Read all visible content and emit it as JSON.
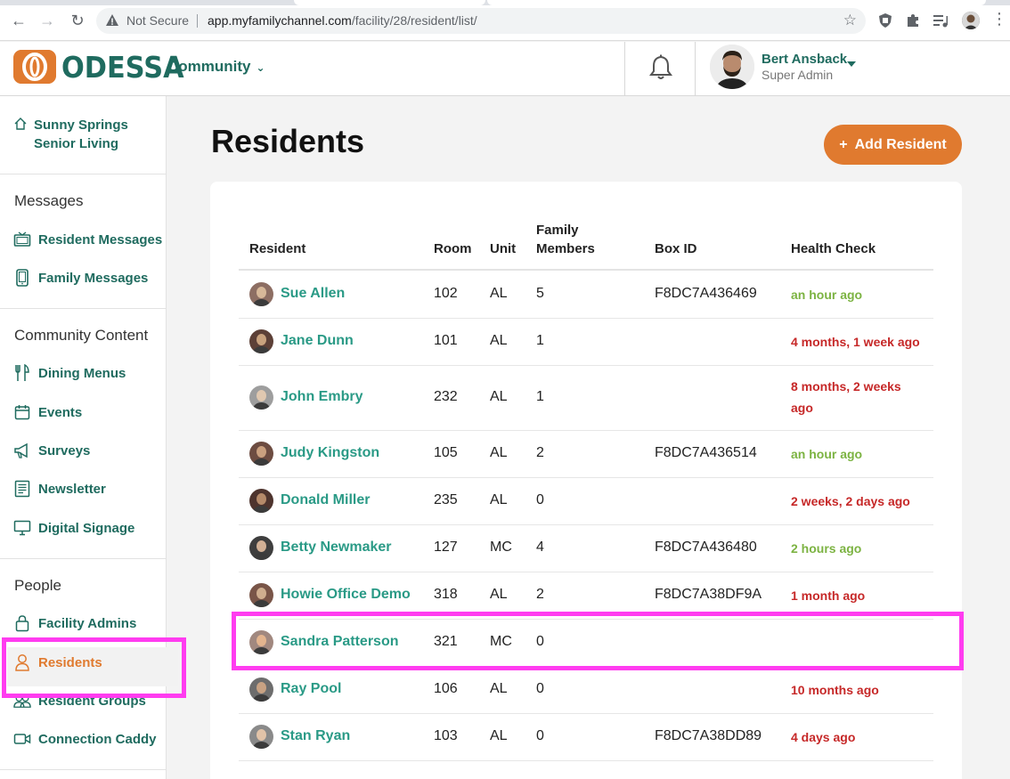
{
  "browser": {
    "security_label": "Not Secure",
    "url_host": "app.myfamilychannel.com",
    "url_path": "/facility/28/resident/list/"
  },
  "header": {
    "logo_text": "ODESSA",
    "community_label": "Community",
    "user_name": "Bert Ansback",
    "user_role": "Super Admin"
  },
  "sidebar": {
    "facility_name": "Sunny Springs Senior Living",
    "sections": [
      {
        "title": "Messages",
        "items": [
          {
            "label": "Resident Messages",
            "icon": "tv-icon"
          },
          {
            "label": "Family Messages",
            "icon": "tablet-icon"
          }
        ]
      },
      {
        "title": "Community Content",
        "items": [
          {
            "label": "Dining Menus",
            "icon": "utensils-icon"
          },
          {
            "label": "Events",
            "icon": "calendar-icon"
          },
          {
            "label": "Surveys",
            "icon": "megaphone-icon"
          },
          {
            "label": "Newsletter",
            "icon": "newsletter-icon"
          },
          {
            "label": "Digital Signage",
            "icon": "monitor-icon"
          }
        ]
      },
      {
        "title": "People",
        "items": [
          {
            "label": "Facility Admins",
            "icon": "lock-icon"
          },
          {
            "label": "Residents",
            "icon": "person-icon",
            "active": true
          },
          {
            "label": "Resident Groups",
            "icon": "group-icon"
          },
          {
            "label": "Connection Caddy",
            "icon": "video-icon"
          }
        ]
      }
    ]
  },
  "main": {
    "title": "Residents",
    "add_button": "Add Resident",
    "columns": [
      "Resident",
      "Room",
      "Unit",
      "Family Members",
      "Box ID",
      "Health Check"
    ],
    "rows": [
      {
        "name": "Sue Allen",
        "room": "102",
        "unit": "AL",
        "family": "5",
        "box_id": "F8DC7A436469",
        "health": "an hour ago",
        "status": "green"
      },
      {
        "name": "Jane Dunn",
        "room": "101",
        "unit": "AL",
        "family": "1",
        "box_id": "",
        "health": "4 months, 1 week ago",
        "status": "red"
      },
      {
        "name": "John Embry",
        "room": "232",
        "unit": "AL",
        "family": "1",
        "box_id": "",
        "health": "8 months, 2 weeks ago",
        "status": "red"
      },
      {
        "name": "Judy Kingston",
        "room": "105",
        "unit": "AL",
        "family": "2",
        "box_id": "F8DC7A436514",
        "health": "an hour ago",
        "status": "green"
      },
      {
        "name": "Donald Miller",
        "room": "235",
        "unit": "AL",
        "family": "0",
        "box_id": "",
        "health": "2 weeks, 2 days ago",
        "status": "red"
      },
      {
        "name": "Betty Newmaker",
        "room": "127",
        "unit": "MC",
        "family": "4",
        "box_id": "F8DC7A436480",
        "health": "2 hours ago",
        "status": "green"
      },
      {
        "name": "Howie Office Demo",
        "room": "318",
        "unit": "AL",
        "family": "2",
        "box_id": "F8DC7A38DF9A",
        "health": "1 month ago",
        "status": "red"
      },
      {
        "name": "Sandra Patterson",
        "room": "321",
        "unit": "MC",
        "family": "0",
        "box_id": "",
        "health": "",
        "status": ""
      },
      {
        "name": "Ray Pool",
        "room": "106",
        "unit": "AL",
        "family": "0",
        "box_id": "",
        "health": "10 months ago",
        "status": "red"
      },
      {
        "name": "Stan Ryan",
        "room": "103",
        "unit": "AL",
        "family": "0",
        "box_id": "F8DC7A38DD89",
        "health": "4 days ago",
        "status": "red"
      }
    ]
  },
  "colors": {
    "brand_teal": "#1f6b5f",
    "link_teal": "#2a9a86",
    "accent_orange": "#e07a2f",
    "health_ok": "#7cb342",
    "health_bad": "#c62828",
    "highlight": "#ff3cf0"
  }
}
